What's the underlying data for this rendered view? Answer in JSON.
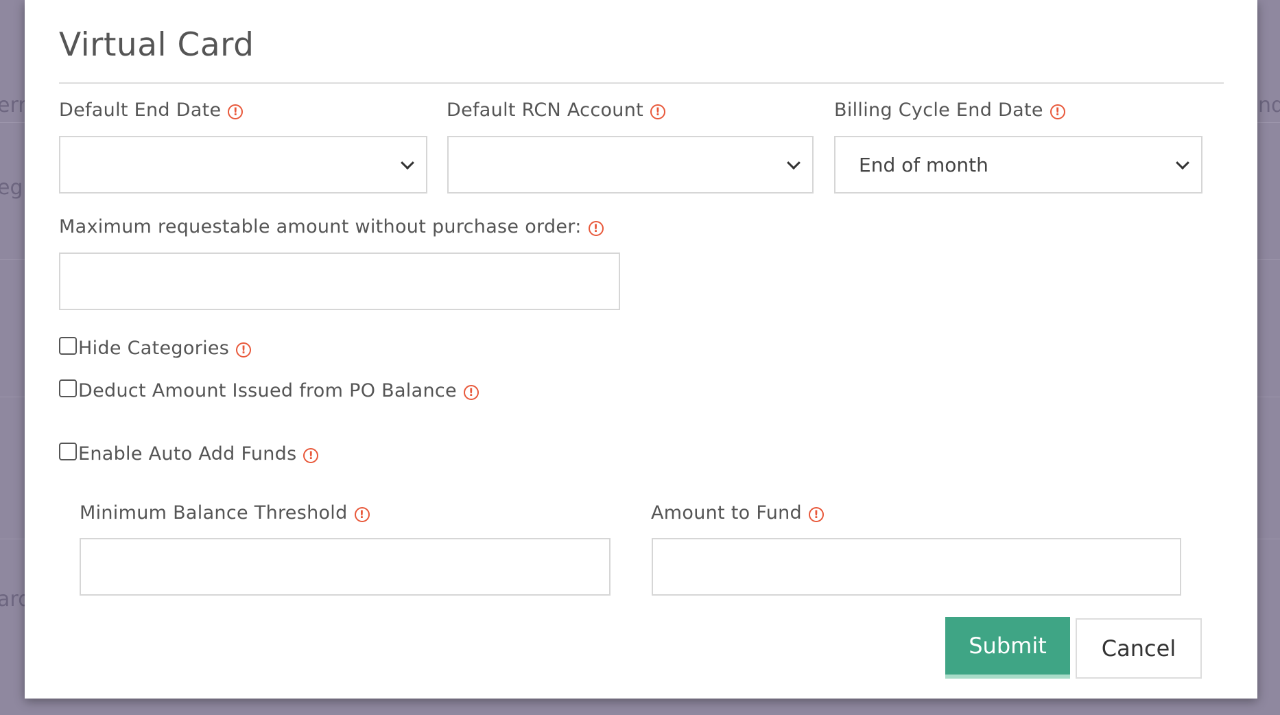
{
  "background_fragments": [
    "err",
    "eg",
    "ard",
    "nd"
  ],
  "modal": {
    "title": "Virtual Card",
    "fields": {
      "default_end_date": {
        "label": "Default End Date",
        "value": ""
      },
      "default_rcn_account": {
        "label": "Default RCN Account",
        "value": ""
      },
      "billing_cycle_end_date": {
        "label": "Billing Cycle End Date",
        "value": "End of month"
      },
      "max_amount": {
        "label": "Maximum requestable amount without purchase order:",
        "value": ""
      },
      "min_balance_threshold": {
        "label": "Minimum Balance Threshold",
        "value": ""
      },
      "amount_to_fund": {
        "label": "Amount to Fund",
        "value": ""
      }
    },
    "checkboxes": {
      "hide_categories": {
        "label": "Hide Categories",
        "checked": false
      },
      "deduct_amount": {
        "label": "Deduct Amount Issued from PO Balance",
        "checked": false
      },
      "enable_auto_add": {
        "label": "Enable Auto Add Funds",
        "checked": false
      }
    },
    "buttons": {
      "submit": "Submit",
      "cancel": "Cancel"
    },
    "info_icon_glyph": "!",
    "colors": {
      "accent": "#3fa585",
      "info": "#e8583a"
    }
  }
}
